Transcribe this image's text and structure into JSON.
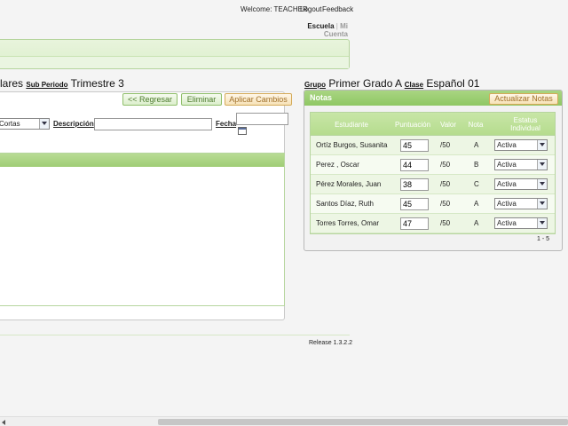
{
  "topbar": {
    "welcome": "Welcome: TEACHER",
    "logout": "Logout",
    "feedback": "Feedback"
  },
  "nav": {
    "school": "Escuela",
    "separator": "|",
    "account": "Mi Cuenta"
  },
  "left": {
    "title_prefix": "lares",
    "subperiod_label": "Sub Periodo",
    "subperiod_value": "Trimestre 3",
    "buttons": {
      "back": "<< Regresar",
      "delete": "Eliminar",
      "apply": "Aplicar Cambios"
    },
    "type_value": "Cortas",
    "description_label": "Descripción",
    "description_value": "",
    "date_label": "Fecha",
    "date_value": ""
  },
  "right": {
    "group_label": "Grupo",
    "group_value": "Primer Grado A",
    "class_label": "Clase",
    "class_value": "Español 01",
    "panel_title": "Notas",
    "update_button": "Actualizar Notas",
    "columns": {
      "student": "Estudiante",
      "score": "Puntuación",
      "value": "Valor",
      "grade": "Nota",
      "status": "Estatus Individual"
    },
    "rows": [
      {
        "student": "Ortíz Burgos, Susanita",
        "score": "45",
        "value": "/50",
        "grade": "A",
        "status": "Activa"
      },
      {
        "student": "Perez , Oscar",
        "score": "44",
        "value": "/50",
        "grade": "B",
        "status": "Activa"
      },
      {
        "student": "Pérez Morales, Juan",
        "score": "38",
        "value": "/50",
        "grade": "C",
        "status": "Activa"
      },
      {
        "student": "Santos Díaz, Ruth",
        "score": "45",
        "value": "/50",
        "grade": "A",
        "status": "Activa"
      },
      {
        "student": "Torres Torres, Omar",
        "score": "47",
        "value": "/50",
        "grade": "A",
        "status": "Activa"
      }
    ],
    "pager": "1 - 5"
  },
  "footer": {
    "release": "Release 1.3.2.2"
  },
  "colors": {
    "accent_green": "#9fcd75",
    "orange_button": "#f7e2b7"
  }
}
